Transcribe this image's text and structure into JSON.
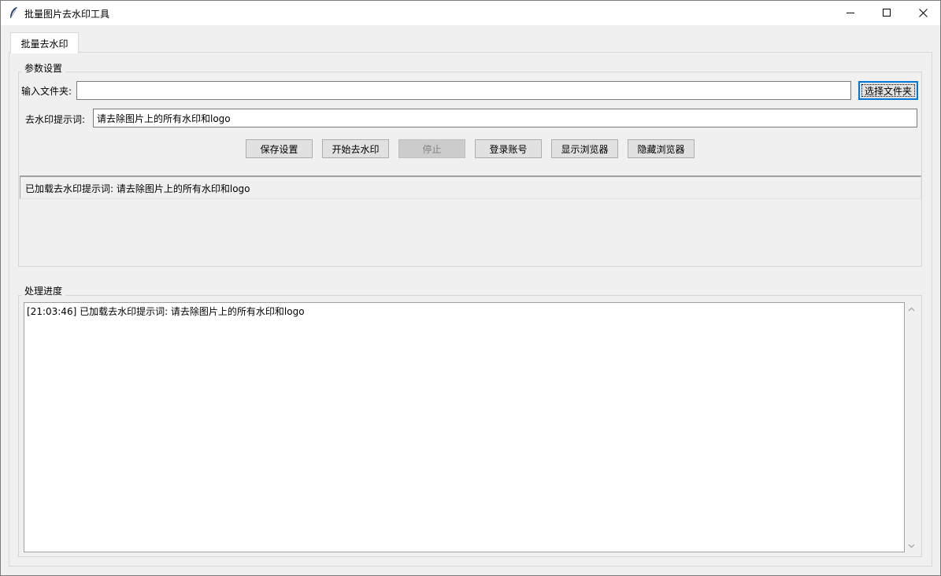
{
  "window": {
    "title": "批量图片去水印工具",
    "icon": "feather-icon",
    "controls": [
      "minimize-icon",
      "maximize-icon",
      "close-icon"
    ]
  },
  "tabs": [
    {
      "label": "批量去水印",
      "selected": true
    }
  ],
  "params": {
    "group_title": "参数设置",
    "input_folder_label": "输入文件夹:",
    "input_folder_value": "",
    "browse_label": "选择文件夹",
    "prompt_label": "去水印提示词:",
    "prompt_value": "请去除图片上的所有水印和logo",
    "buttons": {
      "save": "保存设置",
      "start": "开始去水印",
      "stop": "停止",
      "login": "登录账号",
      "show_browser": "显示浏览器",
      "hide_browser": "隐藏浏览器"
    },
    "status_text": "已加载去水印提示词: 请去除图片上的所有水印和logo"
  },
  "progress": {
    "group_title": "处理进度",
    "log_lines": [
      "[21:03:46] 已加载去水印提示词: 请去除图片上的所有水印和logo"
    ]
  },
  "colors": {
    "titlebar_bg": "#ffffff",
    "window_bg": "#f0f0f0",
    "button_bg": "#e1e1e1",
    "button_focus_border": "#0078d7",
    "disabled_text": "#838383"
  }
}
